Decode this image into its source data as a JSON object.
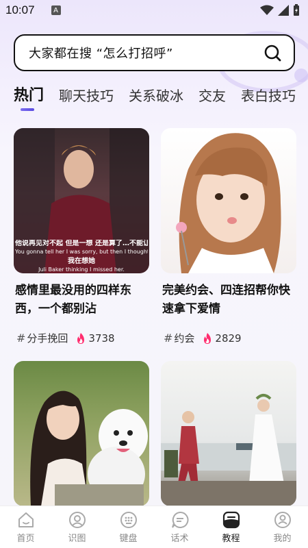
{
  "status": {
    "time": "10:07",
    "a_badge": "A"
  },
  "search": {
    "prefix": "大家都在搜",
    "query": "“怎么打招呼”"
  },
  "tabs": [
    {
      "label": "热门",
      "active": true
    },
    {
      "label": "聊天技巧"
    },
    {
      "label": "关系破冰"
    },
    {
      "label": "交友"
    },
    {
      "label": "表白技巧"
    }
  ],
  "cards": [
    {
      "title": "感情里最没用的四样东西，一个都别沾",
      "tag": "分手挽回",
      "count": "3738",
      "subtitle_cn": "他说再见对不起 但是一想 还是算了…不能让",
      "subtitle_en": "You gonna tell her I was sorry, but then I thought, hey, d...",
      "subtitle_cn2": "我在想她",
      "subtitle_en2": "Juli Baker thinking I missed her."
    },
    {
      "title": "完美约会、四连招帮你快速拿下爱情",
      "tag": "约会",
      "count": "2829"
    },
    {
      "title": "",
      "tag": "",
      "count": ""
    },
    {
      "title": "",
      "tag": "",
      "count": ""
    }
  ],
  "nav": [
    {
      "label": "首页",
      "icon": "home-icon"
    },
    {
      "label": "识图",
      "icon": "scan-image-icon"
    },
    {
      "label": "键盘",
      "icon": "keyboard-icon"
    },
    {
      "label": "话术",
      "icon": "chat-bubble-icon"
    },
    {
      "label": "教程",
      "icon": "tutorial-icon",
      "active": true
    },
    {
      "label": "我的",
      "icon": "profile-icon"
    }
  ],
  "colors": {
    "accent": "#6b5ce7",
    "fire": "#ff2d6f"
  }
}
